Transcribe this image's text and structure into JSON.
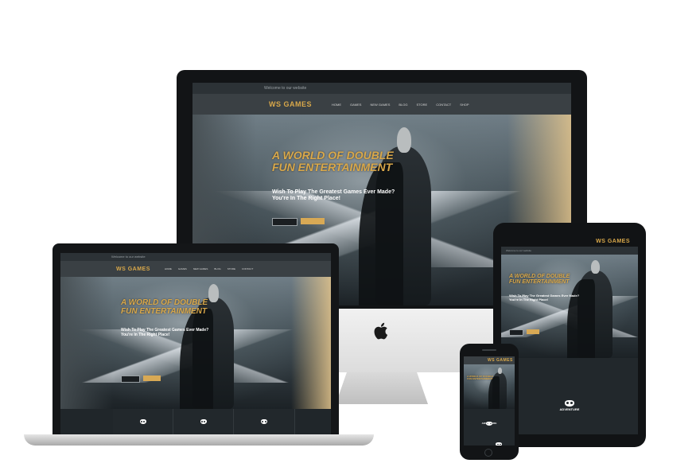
{
  "site": {
    "logo_text": "WS GAMES",
    "topbar_text": "Welcome to our website",
    "nav_items": [
      "HOME",
      "GAMES",
      "NEW GAMES",
      "BLOG",
      "STORE",
      "CONTACT",
      "SHOP"
    ],
    "hero_headline": [
      "A WORLD OF DOUBLE",
      "FUN ENTERTAINMENT"
    ],
    "hero_sub": [
      "Wish To Play The Greatest Games Ever Made?",
      "You're In The Right Place!"
    ],
    "btn_primary": "",
    "btn_secondary": "",
    "feature_title": "ADVENTURE"
  },
  "colors": {
    "accent_gold": "#d9a84a",
    "dark_bg": "#20262a",
    "nav_bg": "#3a4044"
  },
  "icons": {
    "brand_logo": "apple-logo-icon",
    "feature": "mask-icon"
  }
}
